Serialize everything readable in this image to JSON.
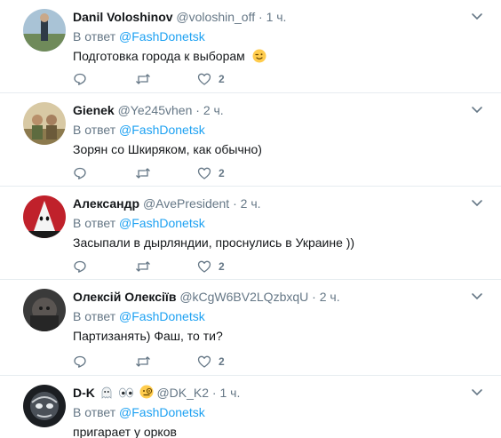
{
  "tweets": [
    {
      "name": "Danil Voloshinov",
      "handle": "@voloshin_off",
      "dot": "·",
      "time": "1 ч.",
      "reply_prefix": "В ответ",
      "reply_mention": "@FashDonetsk",
      "text": "Подготовка города к выборам",
      "text_emoji": "winking-face-emoji",
      "likes": "2"
    },
    {
      "name": "Gienek",
      "handle": "@Ye245vhen",
      "dot": "·",
      "time": "2 ч.",
      "reply_prefix": "В ответ",
      "reply_mention": "@FashDonetsk",
      "text": "Зорян со Шкиряком, как обычно)",
      "likes": "2"
    },
    {
      "name": "Александр",
      "handle": "@AvePresident",
      "dot": "·",
      "time": "2 ч.",
      "reply_prefix": "В ответ",
      "reply_mention": "@FashDonetsk",
      "text": "Засыпали в дырляндии, проснулись в Украине ))",
      "likes": "2"
    },
    {
      "name": "Олексій Олексіїв",
      "handle": "@kCgW6BV2LQzbxqU",
      "dot": "·",
      "time": "2 ч.",
      "reply_prefix": "В ответ",
      "reply_mention": "@FashDonetsk",
      "text": "Партизанять) Фаш, то ти?",
      "likes": "2"
    },
    {
      "name": "D-K",
      "name_emojis": [
        "ghost-emoji",
        "eyes-emoji",
        "face-with-monocle-emoji"
      ],
      "handle": "@DK_K2",
      "dot": "·",
      "time": "1 ч.",
      "reply_prefix": "В ответ",
      "reply_mention": "@FashDonetsk",
      "text": "пригарает у орков"
    }
  ],
  "colors": {
    "accent": "#1da1f2",
    "secondary_text": "#657786",
    "divider": "#e6ecf0"
  }
}
